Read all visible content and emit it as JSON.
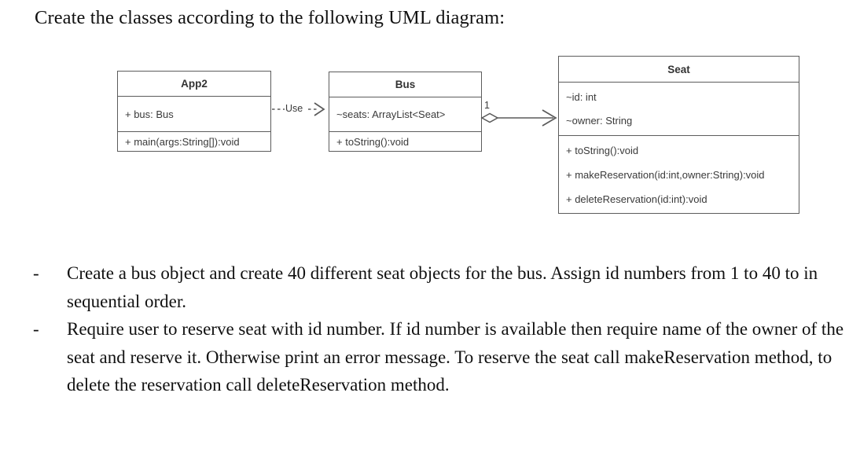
{
  "heading": "Create the classes according to the following UML diagram:",
  "diagram": {
    "type": "uml-class-diagram",
    "classes": [
      {
        "id": "App2",
        "name": "App2",
        "attributes": [
          "+ bus: Bus"
        ],
        "methods": [
          "+ main(args:String[]):void"
        ]
      },
      {
        "id": "Bus",
        "name": "Bus",
        "attributes": [
          "~seats: ArrayList<Seat>"
        ],
        "methods": [
          "+ toString():void"
        ]
      },
      {
        "id": "Seat",
        "name": "Seat",
        "attributes": [
          "~id: int",
          "~owner: String"
        ],
        "methods": [
          "+ toString():void",
          "+ makeReservation(id:int,owner:String):void",
          "+ deleteReservation(id:int):void"
        ]
      }
    ],
    "relationships": [
      {
        "from": "App2",
        "to": "Bus",
        "kind": "dependency",
        "line": "dashed",
        "label": "Use",
        "arrow": "open"
      },
      {
        "from": "Bus",
        "to": "Seat",
        "kind": "aggregation",
        "line": "solid",
        "source_multiplicity": "1",
        "source_decoration": "hollow-diamond",
        "arrow": "open"
      }
    ],
    "colors": {
      "box_border": "#5c5c5c",
      "box_fill": "#ffffff",
      "text": "#3a3a3a",
      "connector": "#5a5a5a"
    }
  },
  "tasks": {
    "marker": "-",
    "items": [
      "Create a bus object and create 40 different seat objects for the bus. Assign id numbers from 1 to 40 to in sequential order.",
      "Require user to reserve seat with id number. If id number is available then require name of the owner of the seat and reserve it. Otherwise print an error message. To reserve the seat call makeReservation method, to delete the reservation call deleteReservation method."
    ]
  }
}
